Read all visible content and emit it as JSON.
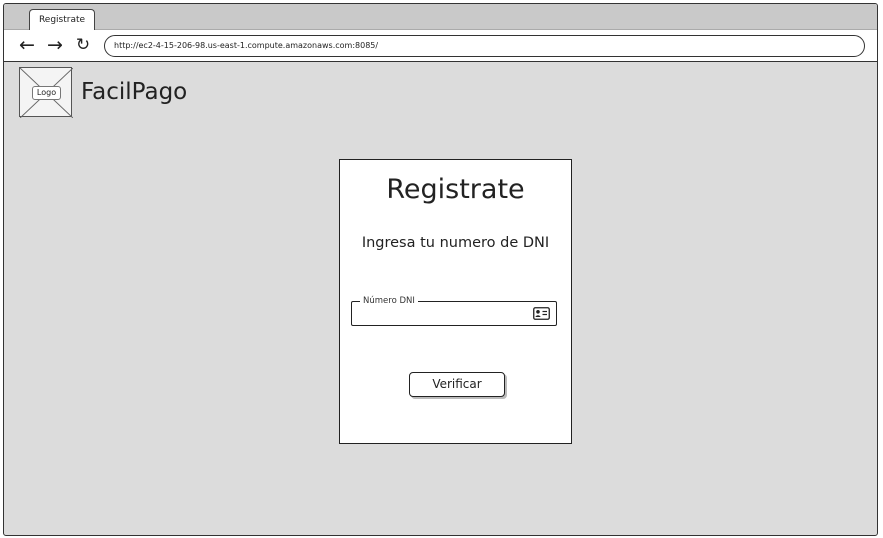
{
  "browser": {
    "tab_title": "Registrate",
    "back_icon": "arrow-left-icon",
    "forward_icon": "arrow-right-icon",
    "reload_icon": "reload-icon",
    "url": "http://ec2-4-15-206-98.us-east-1.compute.amazonaws.com:8085/"
  },
  "header": {
    "logo_label": "Logo",
    "brand_name": "FacilPago"
  },
  "form": {
    "title": "Registrate",
    "subtitle": "Ingresa tu numero de DNI",
    "dni_label": "Número DNI",
    "dni_value": "",
    "dni_icon": "id-card-icon",
    "verify_label": "Verificar"
  }
}
